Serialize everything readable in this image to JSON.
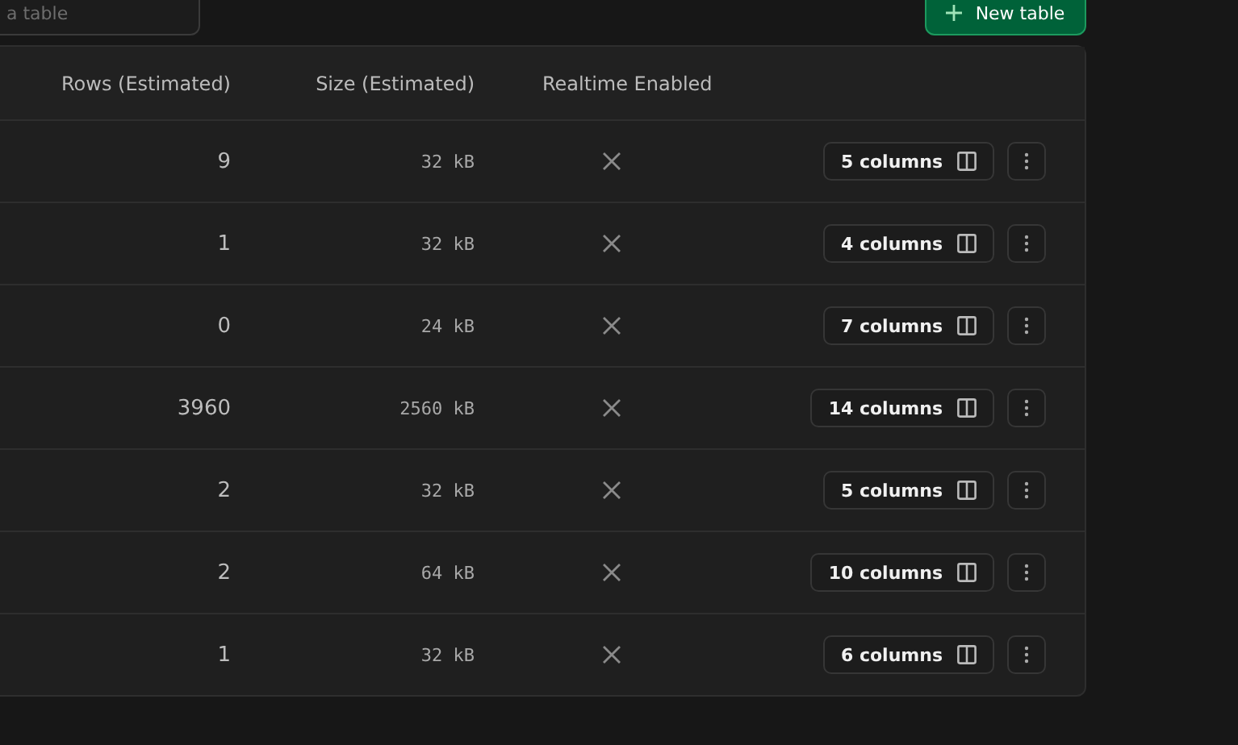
{
  "search": {
    "placeholder": "a table"
  },
  "new_table_button": {
    "label": "New table"
  },
  "table": {
    "columns": [
      "Rows (Estimated)",
      "Size (Estimated)",
      "Realtime Enabled"
    ],
    "rows": [
      {
        "rows": "9",
        "size": "32 kB",
        "realtime": false,
        "columns": "5 columns"
      },
      {
        "rows": "1",
        "size": "32 kB",
        "realtime": false,
        "columns": "4 columns"
      },
      {
        "rows": "0",
        "size": "24 kB",
        "realtime": false,
        "columns": "7 columns"
      },
      {
        "rows": "3960",
        "size": "2560 kB",
        "realtime": false,
        "columns": "14 columns"
      },
      {
        "rows": "2",
        "size": "32 kB",
        "realtime": false,
        "columns": "5 columns"
      },
      {
        "rows": "2",
        "size": "64 kB",
        "realtime": false,
        "columns": "10 columns"
      },
      {
        "rows": "1",
        "size": "32 kB",
        "realtime": false,
        "columns": "6 columns"
      }
    ]
  }
}
